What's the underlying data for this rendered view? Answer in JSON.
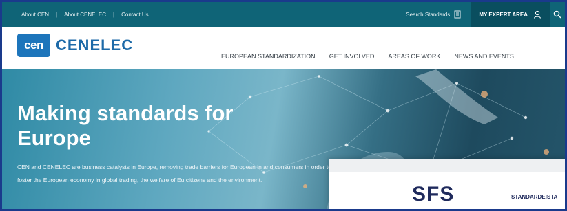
{
  "topbar": {
    "links": [
      "About CEN",
      "About CENELEC",
      "Contact Us"
    ],
    "separator": "|",
    "search_standards": "Search Standards",
    "expert_area": "MY EXPERT AREA"
  },
  "header": {
    "logo_mark": "cen",
    "logo_text": "CENELEC",
    "nav": [
      "EUROPEAN STANDARDIZATION",
      "GET INVOLVED",
      "AREAS OF WORK",
      "NEWS AND EVENTS"
    ]
  },
  "hero": {
    "title": "Making standards for Europe",
    "text": "CEN and CENELEC are business catalysts in Europe, removing trade barriers for European in and consumers in order to foster the European economy in global trading, the welfare of Eu citizens and the environment."
  },
  "popup": {
    "logo": "SFS",
    "tag": "STANDARDEISTA"
  },
  "colors": {
    "topbar": "#0f6477",
    "expert_bg": "#0a4e5f",
    "brand_blue": "#1d75bb",
    "frame": "#1a3a8c"
  }
}
